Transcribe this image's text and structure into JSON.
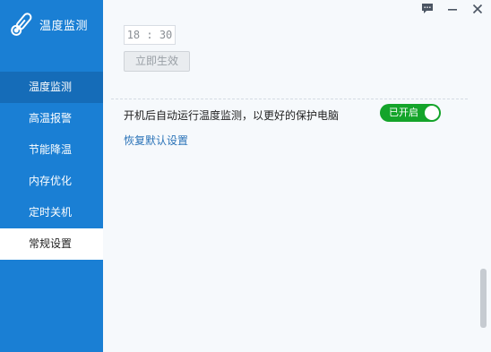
{
  "app": {
    "title": "温度监测",
    "accent_color": "#1a7fd4",
    "icon": "thermometer-icon"
  },
  "window_controls": {
    "feedback_icon": "chat-icon",
    "minimize_icon": "minimize-icon",
    "close_icon": "close-icon"
  },
  "sidebar": {
    "items": [
      {
        "label": "温度监测",
        "state": "hover"
      },
      {
        "label": "高温报警",
        "state": "normal"
      },
      {
        "label": "节能降温",
        "state": "normal"
      },
      {
        "label": "内存优化",
        "state": "normal"
      },
      {
        "label": "定时关机",
        "state": "normal"
      },
      {
        "label": "常规设置",
        "state": "active"
      }
    ]
  },
  "schedule": {
    "time_value": "18 : 30",
    "apply_button_label": "立即生效"
  },
  "general": {
    "autostart_label": "开机后自动运行温度监测，以更好的保护电脑",
    "autostart_toggle_label": "已开启",
    "autostart_enabled": true,
    "toggle_color": "#14a42a",
    "restore_defaults_label": "恢复默认设置"
  }
}
